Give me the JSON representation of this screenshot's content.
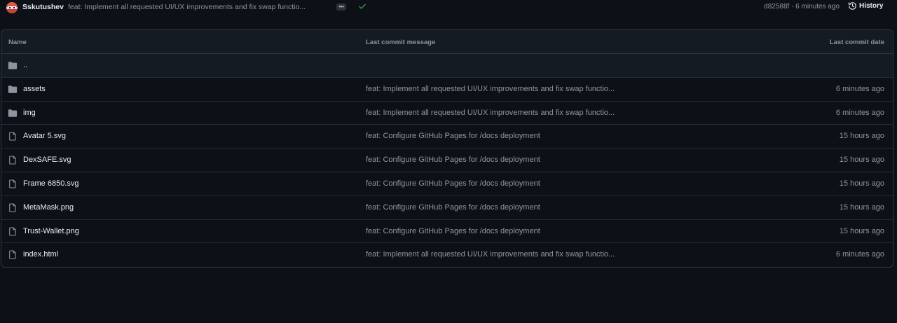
{
  "commit": {
    "author": "Sskutushev",
    "message": "feat: Implement all requested UI/UX improvements and fix swap functio...",
    "dots_label": "•••",
    "sha_time": "d82588f · 6 minutes ago",
    "history_label": "History"
  },
  "table": {
    "headers": {
      "name": "Name",
      "message": "Last commit message",
      "date": "Last commit date"
    },
    "parent": "..",
    "rows": [
      {
        "type": "folder",
        "name": "assets",
        "message": "feat: Implement all requested UI/UX improvements and fix swap functio...",
        "date": "6 minutes ago"
      },
      {
        "type": "folder",
        "name": "img",
        "message": "feat: Implement all requested UI/UX improvements and fix swap functio...",
        "date": "6 minutes ago"
      },
      {
        "type": "file",
        "name": "Avatar 5.svg",
        "message": "feat: Configure GitHub Pages for /docs deployment",
        "date": "15 hours ago"
      },
      {
        "type": "file",
        "name": "DexSAFE.svg",
        "message": "feat: Configure GitHub Pages for /docs deployment",
        "date": "15 hours ago"
      },
      {
        "type": "file",
        "name": "Frame 6850.svg",
        "message": "feat: Configure GitHub Pages for /docs deployment",
        "date": "15 hours ago"
      },
      {
        "type": "file",
        "name": "MetaMask.png",
        "message": "feat: Configure GitHub Pages for /docs deployment",
        "date": "15 hours ago"
      },
      {
        "type": "file",
        "name": "Trust-Wallet.png",
        "message": "feat: Configure GitHub Pages for /docs deployment",
        "date": "15 hours ago"
      },
      {
        "type": "file",
        "name": "index.html",
        "message": "feat: Implement all requested UI/UX improvements and fix swap functio...",
        "date": "6 minutes ago"
      }
    ]
  },
  "icons": {
    "folder": "folder-icon",
    "file": "file-icon",
    "check": "check-icon",
    "history": "history-icon"
  },
  "colors": {
    "background": "#0d1117",
    "header_bg": "#151b23",
    "border": "#30363d",
    "muted_text": "#8d96a0",
    "text": "#e6edf3",
    "success": "#3fb950"
  }
}
